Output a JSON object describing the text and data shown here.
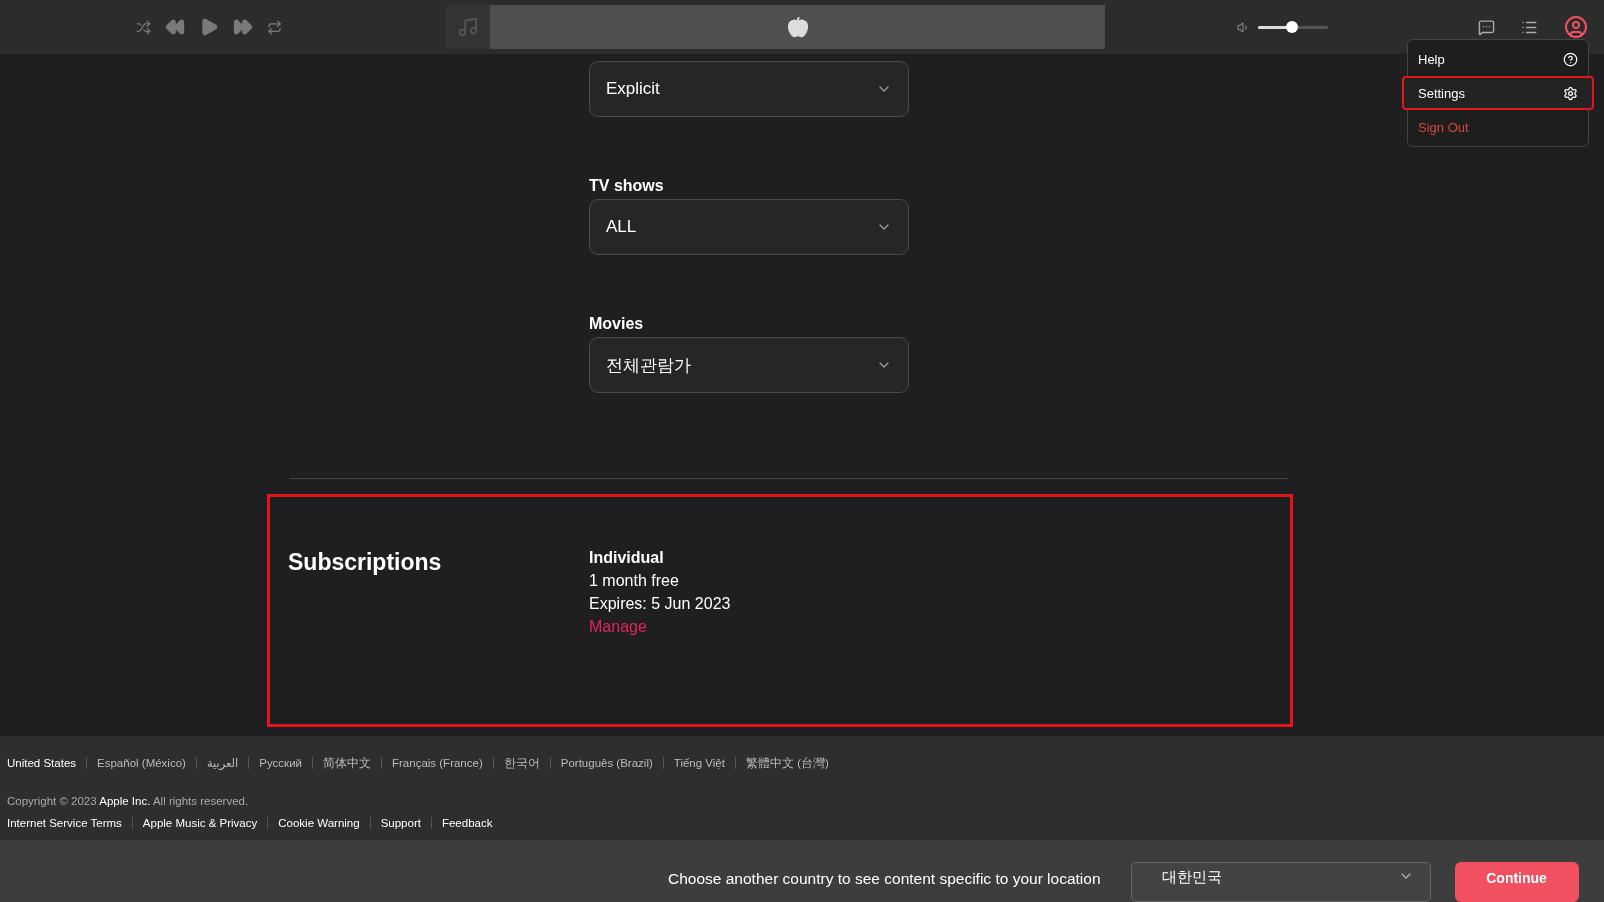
{
  "player": {
    "volume": {
      "level": 0.48
    }
  },
  "menu": {
    "items": [
      {
        "label": "Help",
        "kind": "help",
        "selected": false
      },
      {
        "label": "Settings",
        "kind": "settings",
        "selected": true
      },
      {
        "label": "Sign Out",
        "kind": "signout",
        "selected": false
      }
    ]
  },
  "ratings": [
    {
      "value": "Explicit"
    },
    {
      "label": "TV shows",
      "value": "ALL"
    },
    {
      "label": "Movies",
      "value": "전체관람가"
    }
  ],
  "subscriptions": {
    "highlighted": true,
    "title": "Subscriptions",
    "plan": "Individual",
    "offer": "1 month free",
    "expires": "Expires: 5 Jun 2023",
    "action": "Manage"
  },
  "footer": {
    "languages": [
      {
        "label": "United States",
        "selected": true
      },
      {
        "label": "Español (México)",
        "selected": false
      },
      {
        "label": "العربية",
        "selected": false
      },
      {
        "label": "Русский",
        "selected": false
      },
      {
        "label": "简体中文",
        "selected": false
      },
      {
        "label": "Français (France)",
        "selected": false
      },
      {
        "label": "한국어",
        "selected": false
      },
      {
        "label": "Português (Brazil)",
        "selected": false
      },
      {
        "label": "Tiếng Việt",
        "selected": false
      },
      {
        "label": "繁體中文 (台灣)",
        "selected": false
      }
    ],
    "copyright": "Copyright © 2023 **Apple Inc.** All rights reserved.",
    "links": [
      "Internet Service Terms",
      "Apple Music & Privacy",
      "Cookie Warning",
      "Support",
      "Feedback"
    ]
  },
  "country_bar": {
    "message": "Choose another country to see content specific to your location",
    "country": "대한민국",
    "button": "Continue"
  }
}
